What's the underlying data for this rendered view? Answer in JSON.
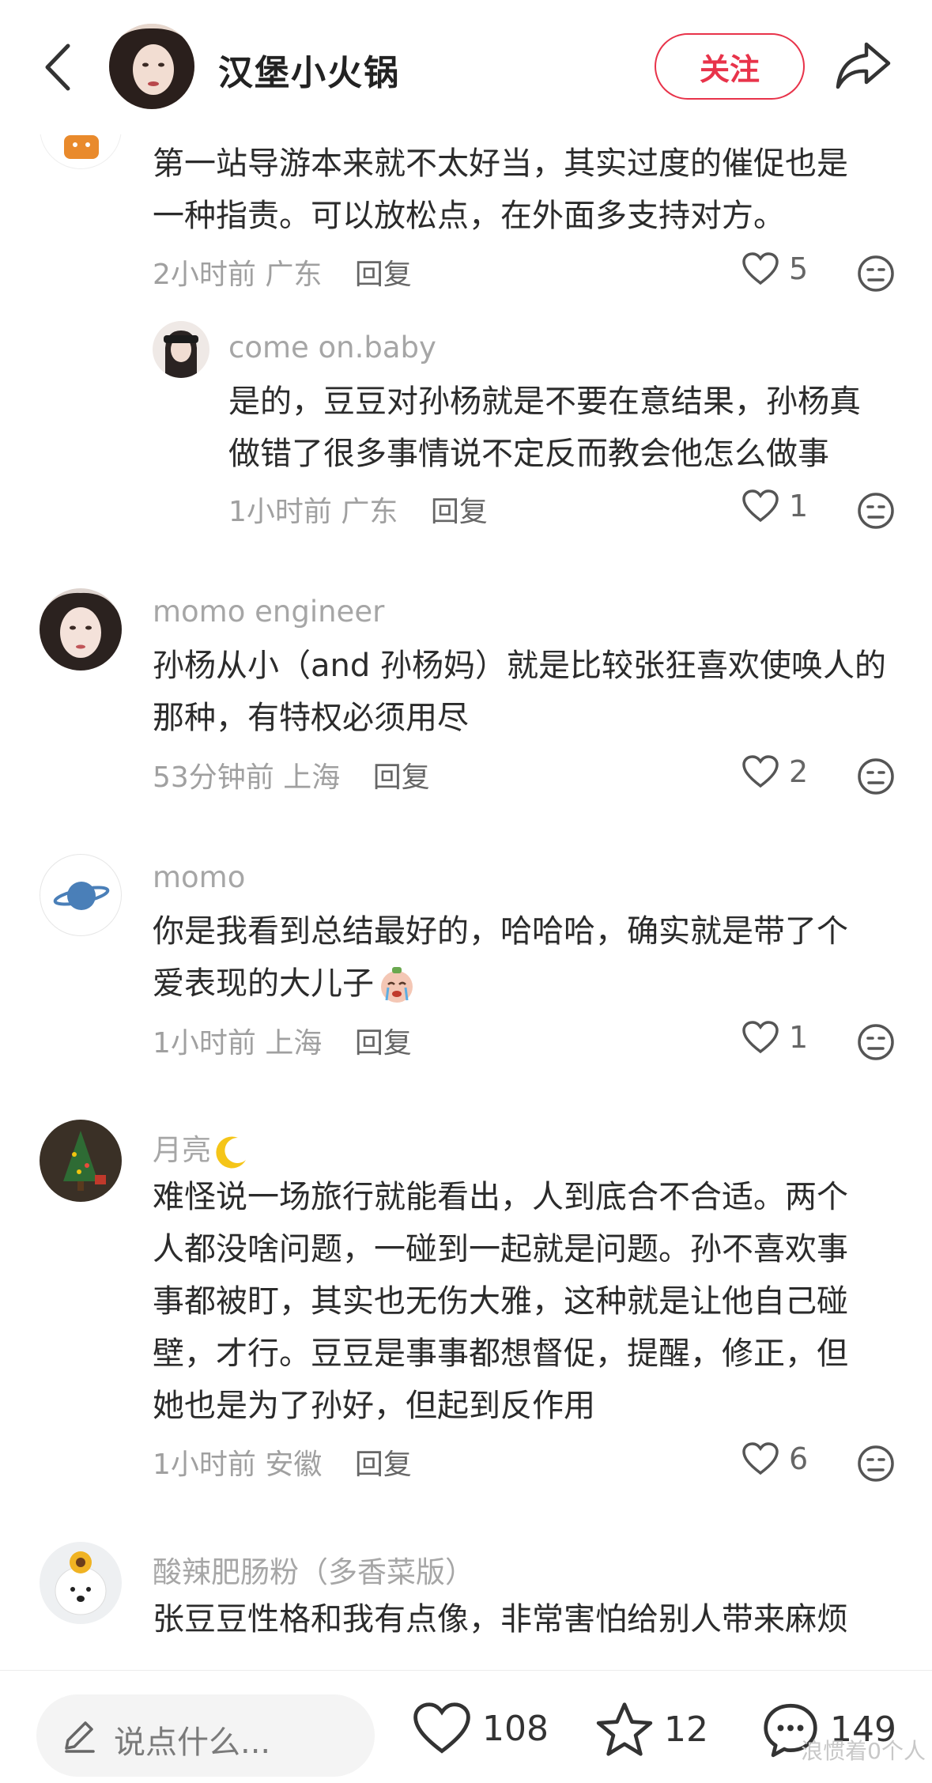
{
  "header": {
    "author_name": "汉堡小火锅",
    "follow_label": "关注",
    "back_icon": "chevron-left-icon",
    "share_icon": "share-icon"
  },
  "comments": [
    {
      "text_line1": "第一站导游本来就不太好当，其实过度的催促也是",
      "text_line2": "一种指责。可以放松点，在外面多支持对方。",
      "time": "2小时前",
      "location": "广东",
      "reply_label": "回复",
      "likes": "5"
    },
    {
      "username": "come on.baby",
      "text_line1": "是的，豆豆对孙杨就是不要在意结果，孙杨真",
      "text_line2": "做错了很多事情说不定反而教会他怎么做事",
      "time": "1小时前",
      "location": "广东",
      "reply_label": "回复",
      "likes": "1"
    },
    {
      "username": "momo engineer",
      "text_line1": "孙杨从小（and 孙杨妈）就是比较张狂喜欢使唤人的",
      "text_line2": "那种，有特权必须用尽",
      "time": "53分钟前",
      "location": "上海",
      "reply_label": "回复",
      "likes": "2"
    },
    {
      "username": "momo",
      "text_line1": "你是我看到总结最好的，哈哈哈，确实就是带了个",
      "text_line2": "爱表现的大儿子",
      "time": "1小时前",
      "location": "上海",
      "reply_label": "回复",
      "likes": "1"
    },
    {
      "username": "月亮",
      "text_line1": "难怪说一场旅行就能看出，人到底合不合适。两个",
      "text_line2": "人都没啥问题，一碰到一起就是问题。孙不喜欢事",
      "text_line3": "事都被盯，其实也无伤大雅，这种就是让他自己碰",
      "text_line4": "壁，才行。豆豆是事事都想督促，提醒，修正，但",
      "text_line5": "她也是为了孙好，但起到反作用",
      "time": "1小时前",
      "location": "安徽",
      "reply_label": "回复",
      "likes": "6"
    },
    {
      "username": "酸辣肥肠粉（多香菜版）",
      "text_line1": "张豆豆性格和我有点像，非常害怕给别人带来麻烦"
    }
  ],
  "bottom_bar": {
    "placeholder": "说点什么...",
    "like_count": "108",
    "star_count": "12",
    "comment_count": "149",
    "watermark": "浪惯着0个人"
  },
  "colors": {
    "accent": "#e8334a",
    "text": "#2b2b2b",
    "meta": "#a0a0a0"
  }
}
